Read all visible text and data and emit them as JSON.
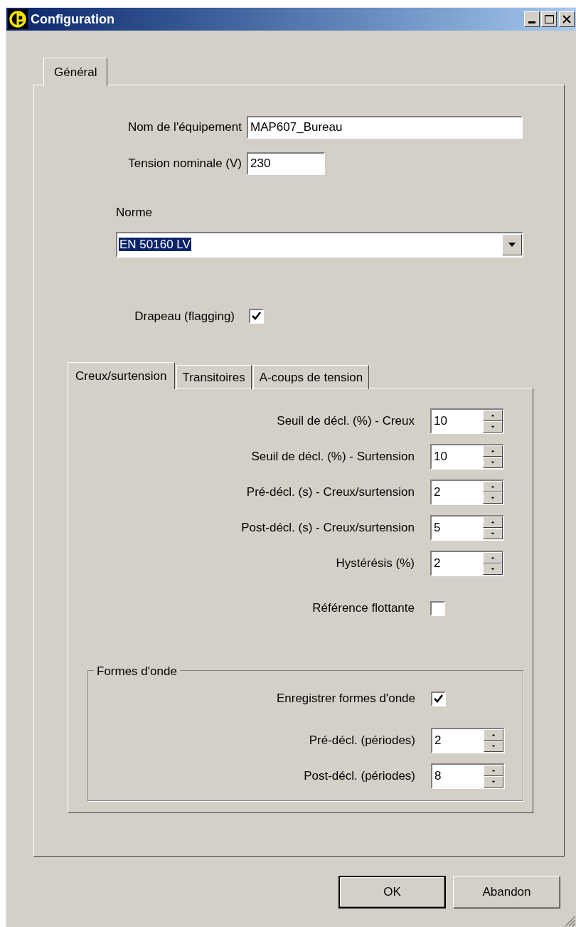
{
  "window": {
    "title": "Configuration"
  },
  "tabs": [
    {
      "label": "Général",
      "selected": true
    }
  ],
  "fields": [
    {
      "label": "Nom de l'équipement",
      "value": "MAP607_Bureau"
    },
    {
      "label": "Tension nominale (V)",
      "value": "230"
    }
  ],
  "standard": {
    "label": "Norme",
    "value": "EN 50160 LV",
    "text_selected": true
  },
  "flagging": {
    "label": "Drapeau (flagging)",
    "checked": true
  },
  "subtabs": [
    {
      "label": "Creux/surtension",
      "selected": true
    },
    {
      "label": "Transitoires",
      "selected": false
    },
    {
      "label": "A-coups de tension",
      "selected": false
    }
  ],
  "settings": [
    {
      "kind": "spin",
      "label": "Seuil de décl. (%) - Creux",
      "value": "10"
    },
    {
      "kind": "spin",
      "label": "Seuil de décl. (%) - Surtension",
      "value": "10"
    },
    {
      "kind": "spin",
      "label": "Pré-décl. (s) - Creux/surtension",
      "value": "2"
    },
    {
      "kind": "spin",
      "label": "Post-décl. (s) - Creux/surtension",
      "value": "5"
    },
    {
      "kind": "spin",
      "label": "Hystérésis (%)",
      "value": "2"
    },
    {
      "kind": "checkbox",
      "label": "Référence flottante",
      "checked": false
    }
  ],
  "waveforms": {
    "title": "Formes d'onde",
    "items": [
      {
        "kind": "checkbox",
        "label": "Enregistrer formes d'onde",
        "checked": true
      },
      {
        "kind": "spin",
        "label": "Pré-décl. (périodes)",
        "value": "2"
      },
      {
        "kind": "spin",
        "label": "Post-décl. (périodes)",
        "value": "8"
      }
    ]
  },
  "buttons": [
    {
      "label": "OK",
      "default": true
    },
    {
      "label": "Abandon",
      "default": false
    }
  ]
}
